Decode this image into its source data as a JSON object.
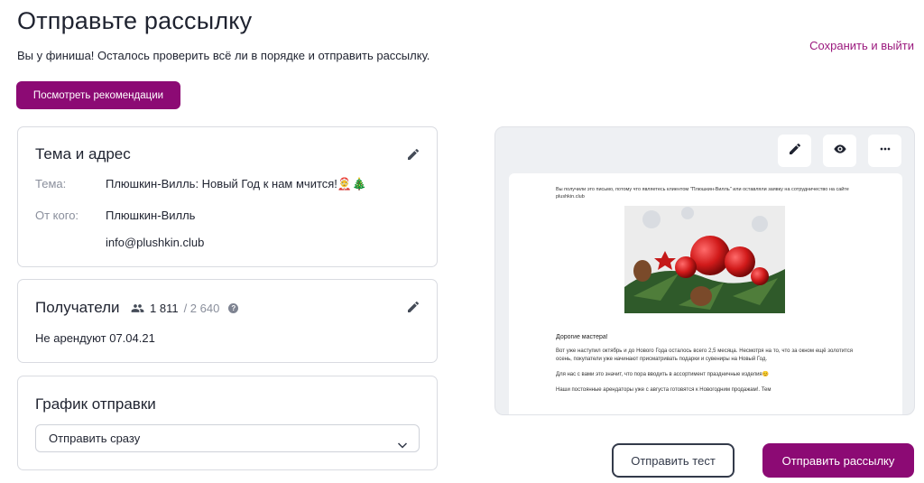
{
  "header": {
    "title": "Отправьте рассылку",
    "subtitle": "Вы у финиша! Осталось проверить всё ли в порядке и отправить рассылку.",
    "save_exit_label": "Сохранить и выйти",
    "recommendations_label": "Посмотреть рекомендации"
  },
  "subject_card": {
    "title": "Тема и адрес",
    "subject_label": "Тема:",
    "subject_value": "Плюшкин-Вилль: Новый Год к нам мчится!🤶🎄",
    "from_label": "От кого:",
    "from_name": "Плюшкин-Вилль",
    "from_email": "info@plushkin.club",
    "edit_icon": "pencil-icon"
  },
  "recipients_card": {
    "title": "Получатели",
    "count": "1 811",
    "total": "/ 2 640",
    "segment": "Не арендуют 07.04.21",
    "people_icon": "people-icon",
    "help_icon": "help-icon",
    "edit_icon": "pencil-icon"
  },
  "schedule_card": {
    "title": "График отправки",
    "selected_option": "Отправить сразу"
  },
  "preview": {
    "tools": [
      "pencil-icon",
      "eye-icon",
      "more-icon"
    ],
    "email": {
      "intro": "Вы получили это письмо, потому что являетесь клиентом \"Плюшкин-Вилль\" или оставляли заявку на сотрудничество на сайте plushkin.club",
      "greeting": "Дорогие мастера!",
      "paragraph1": "Вот уже наступил октябрь и до Нового Года осталось всего 2,5 месяца. Несмотря на то, что за окном ещё золотится осень, покупатели уже начинают присматривать подарки и сувениры на Новый Год.",
      "paragraph2": "Для нас с вами это значит, что пора вводить в ассортимент праздничные изделия😊",
      "paragraph3": "Наши постоянные арендаторы уже с августа готовятся к Новогодним продажам!. Тем"
    }
  },
  "actions": {
    "send_test_label": "Отправить тест",
    "send_label": "Отправить рассылку"
  },
  "colors": {
    "accent": "#8c0a74",
    "link": "#9b1a7e",
    "muted": "#8a8f9c"
  }
}
